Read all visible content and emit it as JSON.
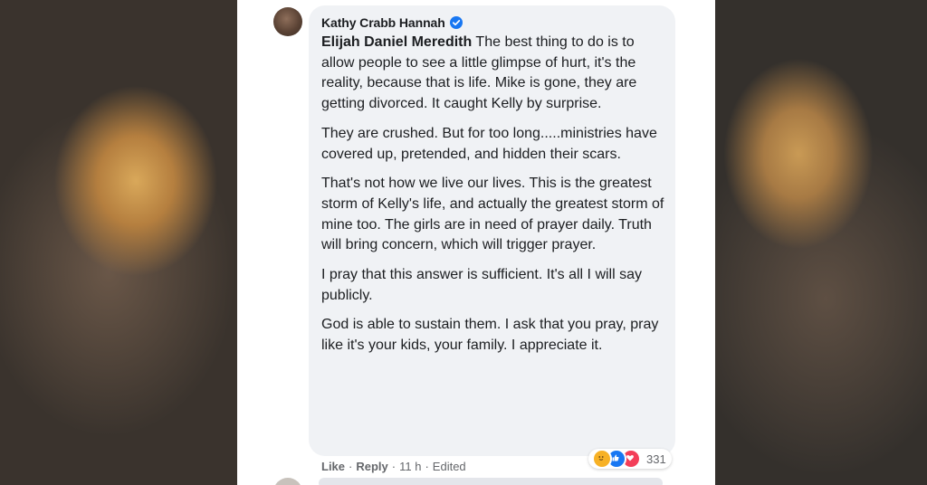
{
  "comment": {
    "author": "Kathy Crabb Hannah",
    "verified_icon": "verified-badge-icon",
    "mention": "Elijah Daniel Meredith",
    "paragraphs": [
      " The best thing to do is to allow people to see a little glimpse of hurt, it's the reality, because that is life. Mike is gone, they are getting divorced. It caught Kelly by surprise.",
      "They are crushed. But for too long.....ministries have covered up, pretended, and hidden their scars.",
      "That's not how we live our lives. This is the greatest storm of Kelly's life, and actually the greatest storm of mine too. The girls are in need of prayer daily. Truth will bring concern, which will trigger prayer.",
      "I pray that this answer is sufficient. It's all I will say publicly.",
      "God is able to sustain them. I ask that you pray, pray like it's your kids, your family. I appreciate it."
    ]
  },
  "footer": {
    "like_label": "Like",
    "separator": "·",
    "reply_label": "Reply",
    "time": "11 h",
    "edited": "Edited"
  },
  "reactions": {
    "icons": [
      "care-reaction-icon",
      "like-reaction-icon",
      "love-reaction-icon"
    ],
    "count": "331"
  },
  "colors": {
    "bubble": "#f0f2f5",
    "text": "#1c1e21",
    "secondary": "#65676b",
    "verified": "#1877f2"
  }
}
